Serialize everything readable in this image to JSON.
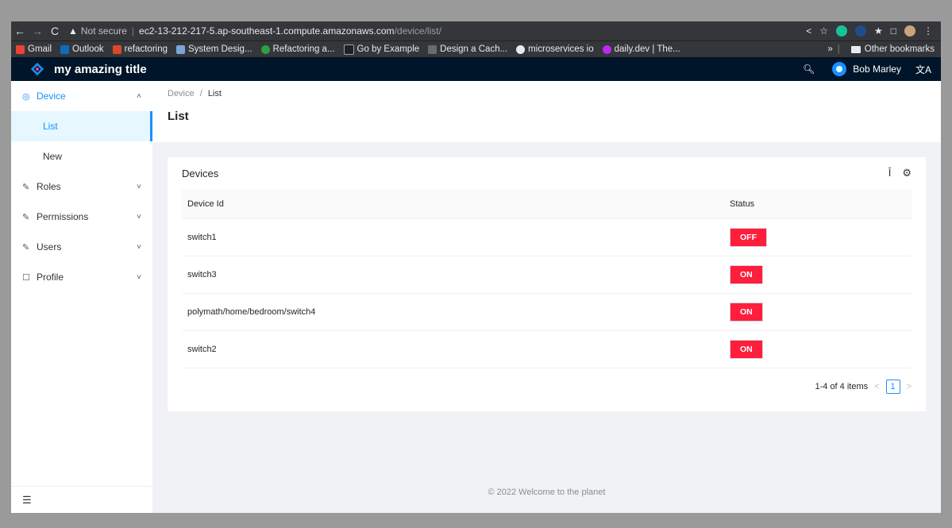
{
  "browser": {
    "url_warning": "Not secure",
    "url_host": "ec2-13-212-217-5.ap-southeast-1.compute.amazonaws.com",
    "url_path": "/device/list/",
    "bookmarks": [
      "Gmail",
      "Outlook",
      "refactoring",
      "System Desig...",
      "Refactoring a...",
      "Go by Example",
      "Design a Cach...",
      "microservices io",
      "daily.dev | The..."
    ],
    "other_bookmarks": "Other bookmarks",
    "more": "»"
  },
  "header": {
    "title": "my amazing title",
    "user": "Bob Marley"
  },
  "sidebar": {
    "device": "Device",
    "list": "List",
    "new": "New",
    "roles": "Roles",
    "permissions": "Permissions",
    "users": "Users",
    "profile": "Profile"
  },
  "page": {
    "breadcrumb_root": "Device",
    "breadcrumb_sep": "/",
    "breadcrumb_current": "List",
    "title": "List"
  },
  "card": {
    "title": "Devices",
    "columns": [
      "Device Id",
      "Status"
    ],
    "rows": [
      {
        "id": "switch1",
        "status": "OFF"
      },
      {
        "id": "switch3",
        "status": "ON"
      },
      {
        "id": "polymath/home/bedroom/switch4",
        "status": "ON"
      },
      {
        "id": "switch2",
        "status": "ON"
      }
    ],
    "pagination_text": "1-4 of 4 items",
    "current_page": "1"
  },
  "footer": {
    "text": "2022 Welcome to the planet"
  },
  "colors": {
    "header_bg": "#001529",
    "accent": "#1890ff",
    "status_badge": "#ff1e3c"
  }
}
